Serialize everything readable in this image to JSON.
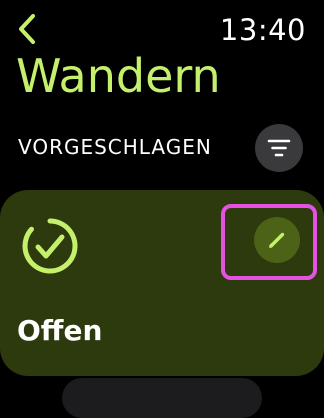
{
  "status_bar": {
    "time": "13:40"
  },
  "header": {
    "title": "Wandern"
  },
  "section": {
    "label": "VORGESCHLAGEN"
  },
  "card": {
    "label": "Offen"
  },
  "icons": {
    "back": "chevron-left-icon",
    "filter": "filter-lines-icon",
    "goal": "checkmark-circle-icon",
    "edit": "pencil-icon"
  },
  "colors": {
    "accent": "#c5f06b",
    "card_background": "#2c3a0d",
    "edit_button": "#4c6217",
    "filter_button": "#3a3a3c",
    "highlight": "#e552e3"
  }
}
